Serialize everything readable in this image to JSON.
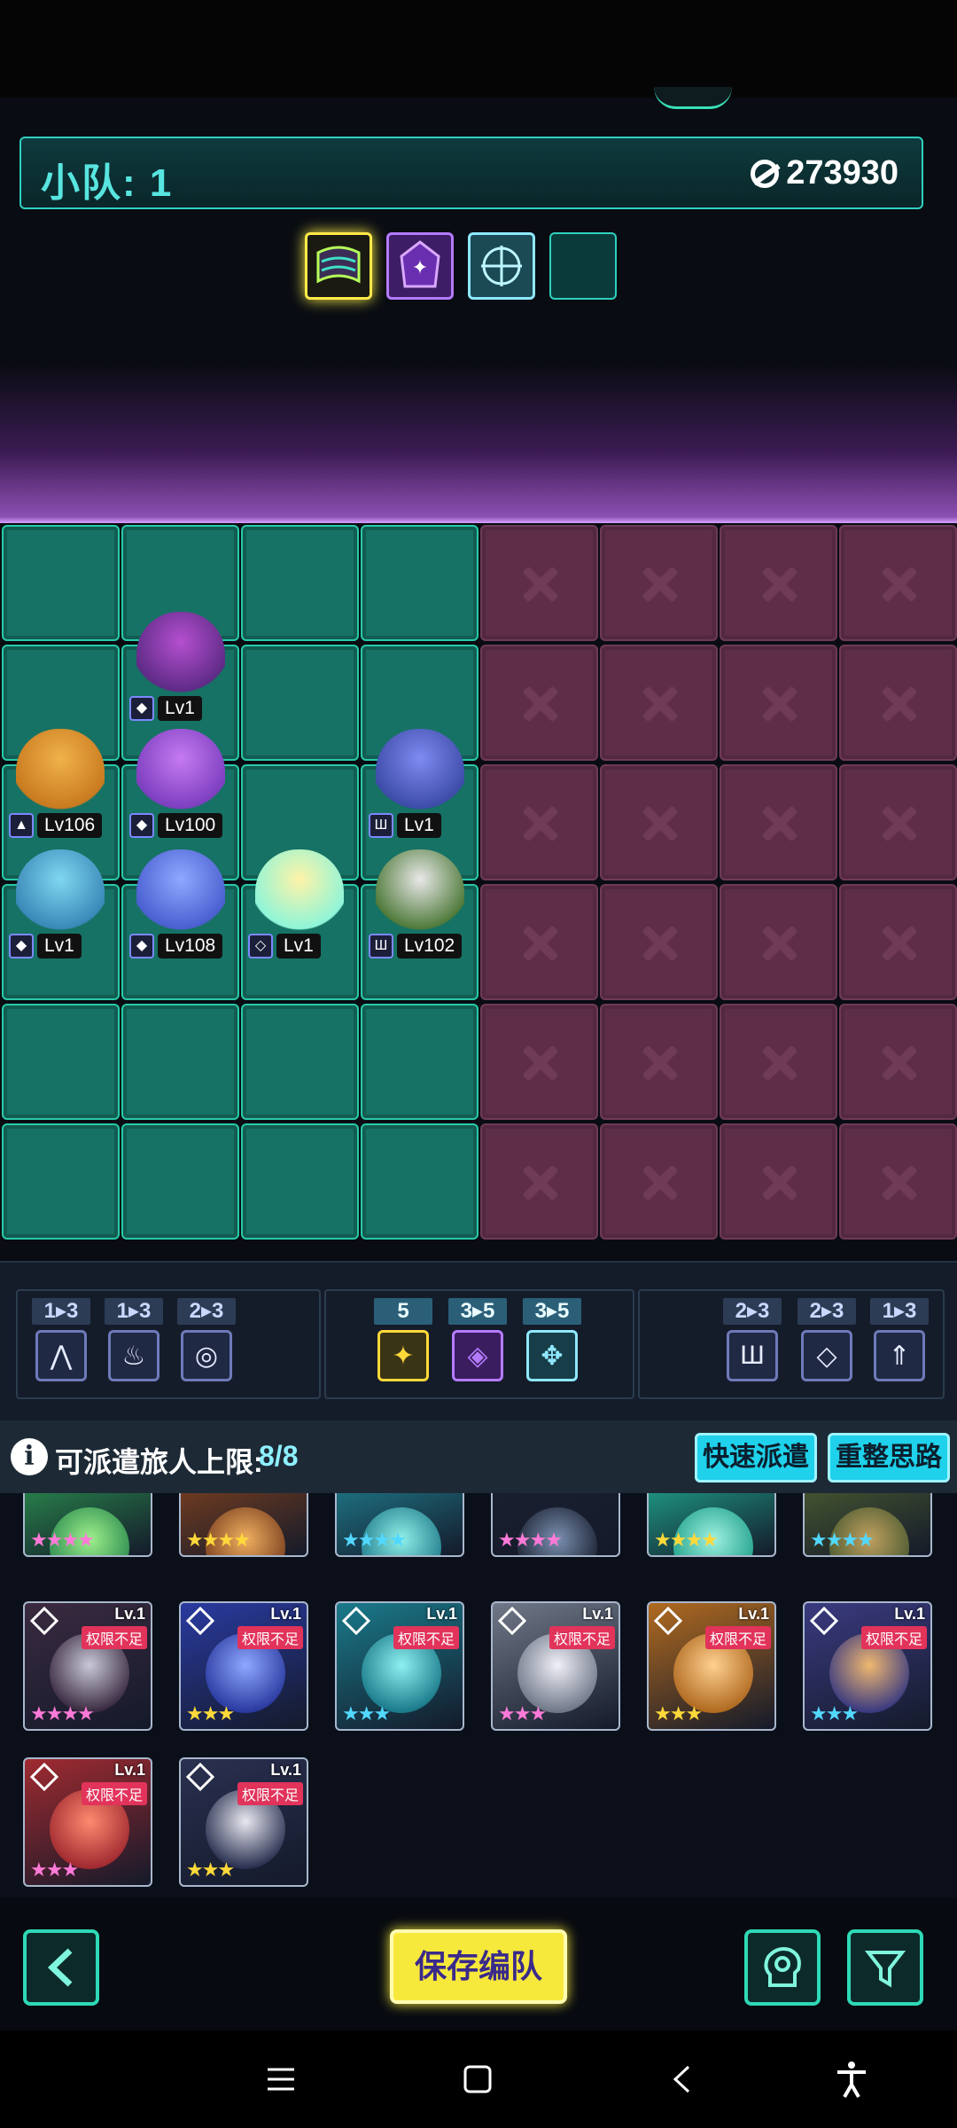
{
  "team": {
    "label": "小队:",
    "number": "1",
    "power": "273930"
  },
  "formations": [
    "formation-wave-icon",
    "formation-star-icon",
    "formation-arrows-icon",
    "formation-empty"
  ],
  "units": [
    {
      "level": "Lv1",
      "cls": "◆"
    },
    {
      "level": "Lv106",
      "cls": "▲"
    },
    {
      "level": "Lv100",
      "cls": "◆"
    },
    {
      "level": "Lv1",
      "cls": "Ш"
    },
    {
      "level": "Lv1",
      "cls": "◆"
    },
    {
      "level": "Lv108",
      "cls": "◆"
    },
    {
      "level": "Lv1",
      "cls": "◇"
    },
    {
      "level": "Lv102",
      "cls": "Ш"
    }
  ],
  "synergies": {
    "left": [
      {
        "count": "1▸3",
        "icon": "mountain-icon",
        "glyph": "⋀"
      },
      {
        "count": "1▸3",
        "icon": "flame-icon",
        "glyph": "♨"
      },
      {
        "count": "2▸3",
        "icon": "swirl-icon",
        "glyph": "◎"
      }
    ],
    "center": [
      {
        "count": "5",
        "icon": "sparkle-icon",
        "glyph": "✦"
      },
      {
        "count": "3▸5",
        "icon": "cube-icon",
        "glyph": "◈"
      },
      {
        "count": "3▸5",
        "icon": "crosshair-icon",
        "glyph": "✥"
      }
    ],
    "right": [
      {
        "count": "2▸3",
        "icon": "shield-icon",
        "glyph": "Ш"
      },
      {
        "count": "2▸3",
        "icon": "diamond-icon",
        "glyph": "◇"
      },
      {
        "count": "1▸3",
        "icon": "arrow-up-icon",
        "glyph": "⇑"
      }
    ]
  },
  "info": {
    "label": "可派遣旅人上限:",
    "value": "8/8",
    "quick_dispatch": "快速派遣",
    "reorganize": "重整思路"
  },
  "roster": {
    "lv_label": "Lv.1",
    "lock_label": "权限不足",
    "stars_3": "★★★",
    "stars_4": "★★★★"
  },
  "save_button": "保存编队",
  "colors": {
    "accent": "#2ed9b6",
    "save": "#f7e83c",
    "locked": "#e2335b",
    "power_text": "#ffffff"
  }
}
